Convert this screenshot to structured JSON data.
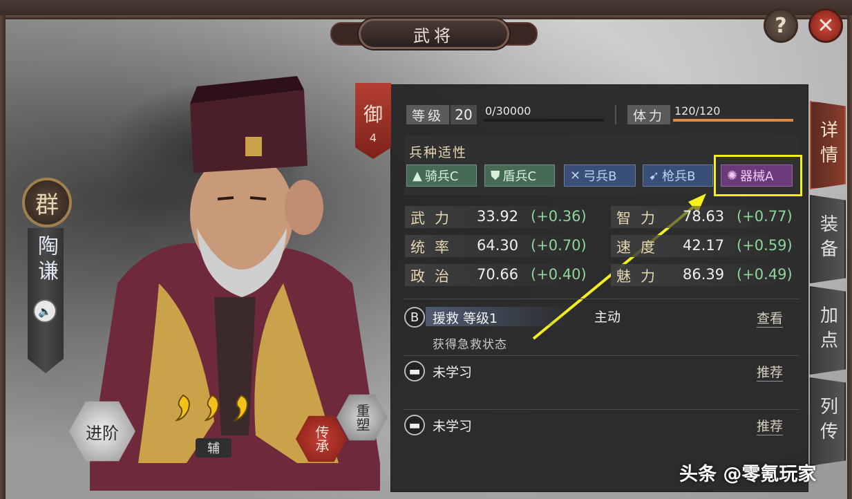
{
  "header": {
    "title": "武将",
    "help_label": "?",
    "close_label": "✕"
  },
  "general": {
    "faction": "群",
    "name": "陶谦",
    "role": "辅",
    "stars": 3,
    "advance_label": "进阶",
    "inherit_label": "传承",
    "remodel_label": "重塑"
  },
  "troop_type": {
    "name": "御",
    "cost": "4"
  },
  "level": {
    "label": "等级",
    "value": "20",
    "exp": "0/30000",
    "exp_ratio": 0.0
  },
  "stamina": {
    "label": "体力",
    "value": "120/120",
    "ratio": 1.0
  },
  "affinity": {
    "title": "兵种适性",
    "items": [
      {
        "label": "骑兵C",
        "icon": "cavalry-icon"
      },
      {
        "label": "盾兵C",
        "icon": "shield-icon"
      },
      {
        "label": "弓兵B",
        "icon": "bow-icon"
      },
      {
        "label": "枪兵B",
        "icon": "spear-icon"
      },
      {
        "label": "器械A",
        "icon": "siege-icon"
      }
    ]
  },
  "stats": [
    {
      "name": "武力",
      "value": "33.92",
      "bonus": "(+0.36)"
    },
    {
      "name": "智力",
      "value": "78.63",
      "bonus": "(+0.77)"
    },
    {
      "name": "统率",
      "value": "64.30",
      "bonus": "(+0.70)"
    },
    {
      "name": "速度",
      "value": "42.17",
      "bonus": "(+0.59)"
    },
    {
      "name": "政治",
      "value": "70.66",
      "bonus": "(+0.40)"
    },
    {
      "name": "魅力",
      "value": "86.39",
      "bonus": "(+0.49)"
    }
  ],
  "skills": [
    {
      "grade": "B",
      "name": "援救 等级1",
      "type": "主动",
      "desc": "获得急救状态",
      "action": "查看"
    },
    {
      "name": "未学习",
      "action": "推荐"
    },
    {
      "name": "未学习",
      "action": "推荐"
    }
  ],
  "tabs": [
    {
      "label": "详情",
      "active": true
    },
    {
      "label": "装备",
      "active": false
    },
    {
      "label": "加点",
      "active": false
    },
    {
      "label": "列传",
      "active": false
    }
  ],
  "watermark": "头条 @零氪玩家",
  "colors": {
    "highlight": "#f4f01e",
    "bonus_green": "#8ed59b",
    "stamina_orange": "#e08a3f"
  }
}
